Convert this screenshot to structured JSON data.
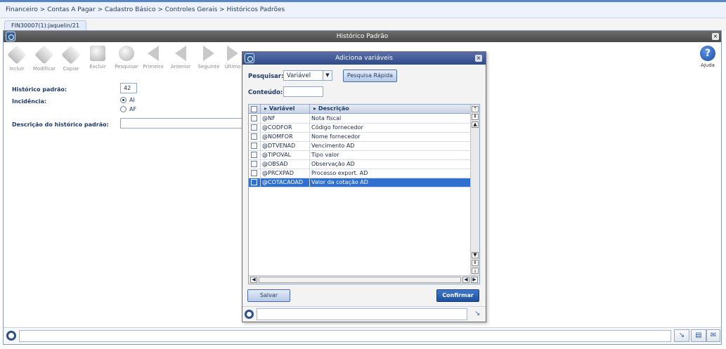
{
  "breadcrumb": "Financeiro > Contas A Pagar > Cadastro Básico > Controles Gerais > Históricos Padrões",
  "tab_label": "FIN30007(1):jaquelin/21",
  "window_title": "Histórico Padrão",
  "toolbar": {
    "incluir": "Incluir",
    "modificar": "Modificar",
    "copiar": "Copiar",
    "excluir": "Excluir",
    "pesquisar": "Pesquisar",
    "primeiro": "Primeiro",
    "anterior": "Anterior",
    "seguinte": "Seguinte",
    "ultimo": "Último",
    "ajuda": "Ajuda"
  },
  "form": {
    "historico_label": "Histórico padrão:",
    "historico_value": "42",
    "incidencia_label": "Incidência:",
    "radio_ai": "AI",
    "radio_af": "AF",
    "descricao_label": "Descrição do histórico padrão:",
    "descricao_value": ""
  },
  "dialog": {
    "title": "Adiciona variáveis",
    "pesquisar_label": "Pesquisar:",
    "pesquisar_value": "Variável",
    "pesquisa_rapida": "Pesquisa Rápida",
    "conteudo_label": "Conteúdo:",
    "conteudo_value": "",
    "col_variavel": "Variável",
    "col_descricao": "Descrição",
    "rows": [
      {
        "variavel": "@NF",
        "descricao": "Nota fiscal"
      },
      {
        "variavel": "@CODFOR",
        "descricao": "Código fornecedor"
      },
      {
        "variavel": "@NOMFOR",
        "descricao": "Nome fornecedor"
      },
      {
        "variavel": "@DTVENAD",
        "descricao": "Vencimento AD"
      },
      {
        "variavel": "@TIPOVAL",
        "descricao": "Tipo valor"
      },
      {
        "variavel": "@OBSAD",
        "descricao": "Observação AD"
      },
      {
        "variavel": "@PRCXPAD",
        "descricao": "Processo export. AD"
      },
      {
        "variavel": "@COTACAOAD",
        "descricao": "Valor da cotação AD"
      }
    ],
    "salvar": "Salvar",
    "confirmar": "Confirmar"
  }
}
